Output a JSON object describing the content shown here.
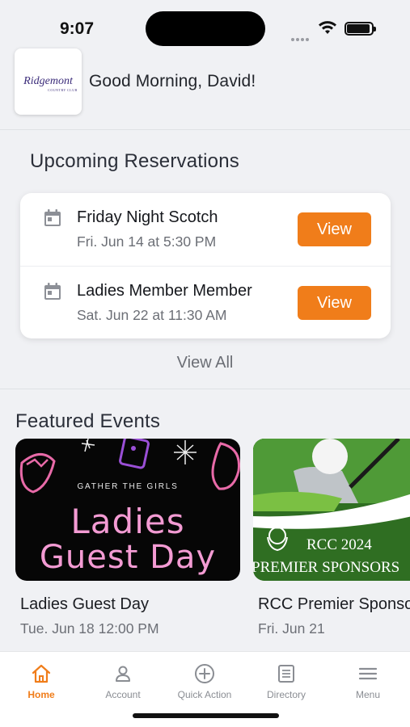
{
  "status_bar": {
    "time": "9:07"
  },
  "header": {
    "logo_name": "Ridgemont",
    "logo_sub": "COUNTRY CLUB",
    "greeting": "Good Morning, David!"
  },
  "reservations": {
    "title": "Upcoming Reservations",
    "items": [
      {
        "title": "Friday Night Scotch",
        "date": "Fri. Jun 14 at 5:30 PM",
        "button": "View"
      },
      {
        "title": "Ladies Member Member",
        "date": "Sat. Jun 22 at 11:30 AM",
        "button": "View"
      }
    ],
    "view_all": "View All"
  },
  "featured": {
    "title": "Featured Events",
    "events": [
      {
        "name": "Ladies Guest Day",
        "date": "Tue. Jun 18 12:00 PM",
        "image_text": {
          "small": "GATHER THE GIRLS",
          "line1": "Ladies",
          "line2": "Guest Day"
        }
      },
      {
        "name": "RCC Premier Sponsors",
        "date": "Fri. Jun 21",
        "image_text": {
          "line1": "RCC 2024",
          "line2": "PREMIER SPONSORS"
        }
      }
    ]
  },
  "tab_bar": {
    "tabs": [
      {
        "label": "Home",
        "icon": "home-icon",
        "active": true
      },
      {
        "label": "Account",
        "icon": "account-icon",
        "active": false
      },
      {
        "label": "Quick Action",
        "icon": "plus-circle-icon",
        "active": false
      },
      {
        "label": "Directory",
        "icon": "directory-icon",
        "active": false
      },
      {
        "label": "Menu",
        "icon": "menu-icon",
        "active": false
      }
    ]
  },
  "colors": {
    "accent": "#f07d1a",
    "background": "#f0f1f4"
  }
}
